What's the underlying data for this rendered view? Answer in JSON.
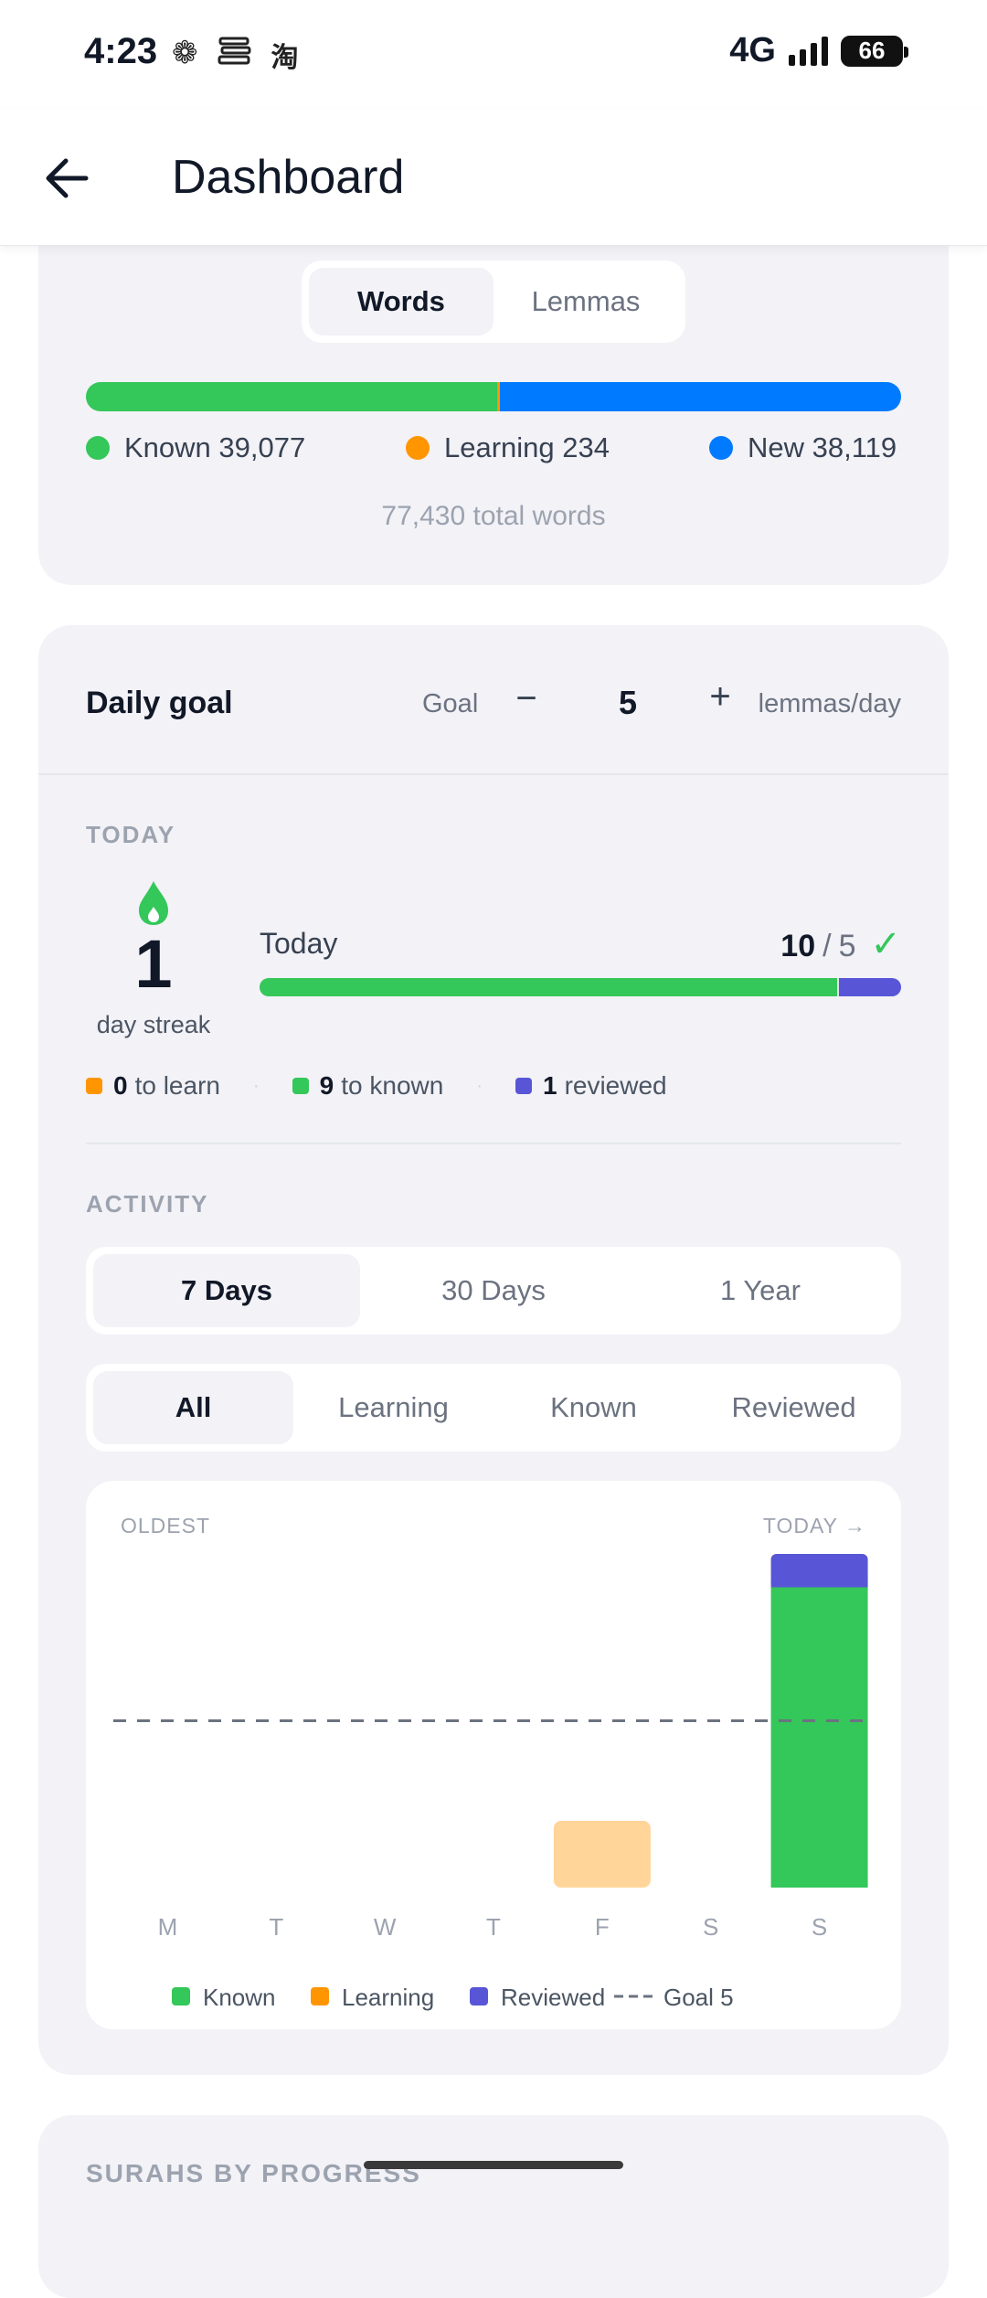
{
  "status_bar": {
    "time": "4:23",
    "icons": [
      "flower-icon",
      "book-stack-icon",
      "taobao-icon"
    ],
    "network": "4G",
    "battery": "66"
  },
  "app_bar": {
    "title": "Dashboard"
  },
  "words_card": {
    "tabs": [
      {
        "label": "Words",
        "active": true
      },
      {
        "label": "Lemmas",
        "active": false
      }
    ],
    "known": {
      "label": "Known 39,077",
      "count": 39077,
      "color": "#34c759"
    },
    "learning": {
      "label": "Learning 234",
      "count": 234,
      "color": "#ff9500"
    },
    "new": {
      "label": "New 38,119",
      "count": 38119,
      "color": "#007aff"
    },
    "total": "77,430 total words"
  },
  "daily_goal": {
    "title": "Daily goal",
    "goal_label": "Goal",
    "minus": "−",
    "value": "5",
    "plus": "+",
    "unit": "lemmas/day"
  },
  "today": {
    "section": "TODAY",
    "streak_value": "1",
    "streak_label": "day streak",
    "progress_label": "Today",
    "done": "10",
    "separator": "/",
    "goal": "5",
    "check": "✓",
    "progress": {
      "known_fraction": 0.9,
      "reviewed_fraction": 0.1
    },
    "stats": [
      {
        "value": "0",
        "label": "to learn",
        "color": "#ff9500"
      },
      {
        "value": "9",
        "label": "to known",
        "color": "#34c759"
      },
      {
        "value": "1",
        "label": "reviewed",
        "color": "#5856d6"
      }
    ]
  },
  "activity": {
    "section": "ACTIVITY",
    "range_tabs": [
      {
        "label": "7 Days",
        "active": true
      },
      {
        "label": "30 Days",
        "active": false
      },
      {
        "label": "1 Year",
        "active": false
      }
    ],
    "filter_tabs": [
      {
        "label": "All",
        "active": true
      },
      {
        "label": "Learning",
        "active": false
      },
      {
        "label": "Known",
        "active": false
      },
      {
        "label": "Reviewed",
        "active": false
      }
    ],
    "oldest_label": "OLDEST",
    "today_label": "TODAY →"
  },
  "chart_data": {
    "type": "bar",
    "stacked": true,
    "categories": [
      "M",
      "T",
      "W",
      "T",
      "F",
      "S",
      "S"
    ],
    "series": [
      {
        "name": "Known",
        "color": "#34c759",
        "values": [
          0,
          0,
          0,
          0,
          0,
          0,
          9
        ]
      },
      {
        "name": "Learning",
        "color": "#ffd599",
        "values": [
          0,
          0,
          0,
          0,
          2,
          0,
          0
        ]
      },
      {
        "name": "Reviewed",
        "color": "#5856d6",
        "values": [
          0,
          0,
          0,
          0,
          0,
          0,
          1
        ]
      }
    ],
    "goal": {
      "label": "Goal 5",
      "value": 5
    },
    "legend": [
      {
        "label": "Known",
        "color": "#34c759"
      },
      {
        "label": "Learning",
        "color": "#ff9500"
      },
      {
        "label": "Reviewed",
        "color": "#5856d6"
      }
    ],
    "ylim": [
      0,
      10
    ],
    "grid": false,
    "legend_position": "bottom"
  },
  "surahs": {
    "section": "SURAHS BY PROGRESS"
  }
}
